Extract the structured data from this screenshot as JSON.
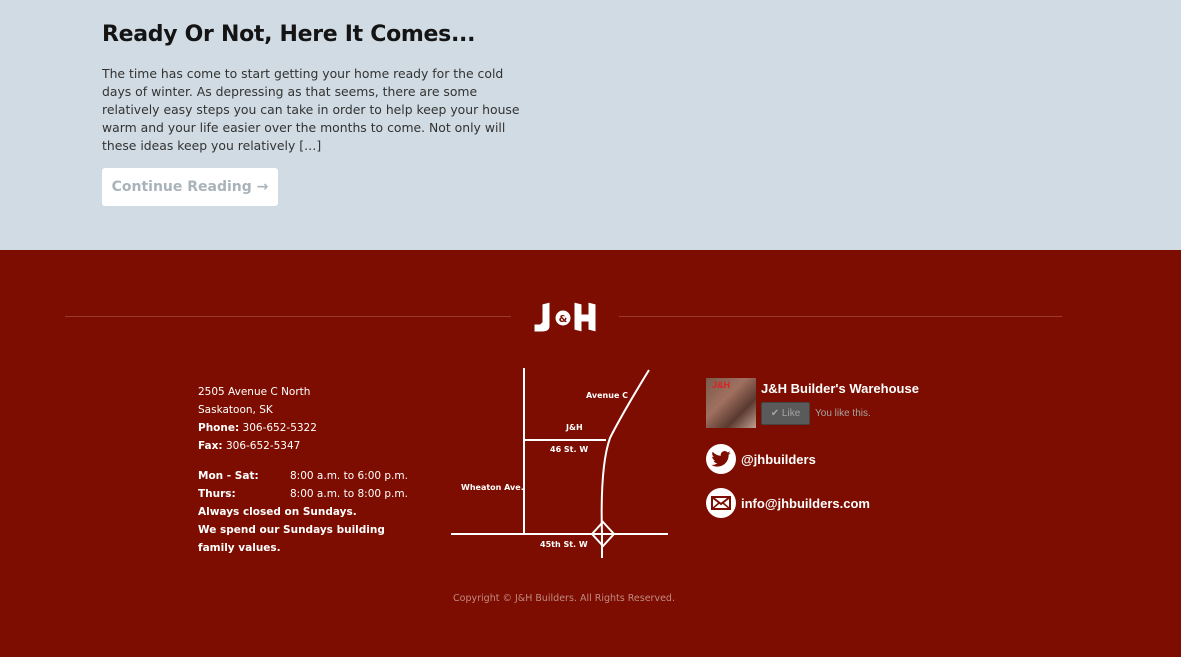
{
  "post": {
    "title": "Ready Or Not, Here It Comes...",
    "excerpt": "The time has come to start getting your home ready for the cold days of winter. As depressing as that seems, there are some relatively easy steps you can take in order to help keep your house warm and your life easier over the months to come. Not only will these ideas keep you relatively […]",
    "continue_label": "Continue Reading →"
  },
  "footer": {
    "logo_text": "J&H",
    "contact": {
      "address_line1": "2505 Avenue C North",
      "address_line2": "Saskatoon, SK",
      "phone_label": "Phone:",
      "phone": "306-652-5322",
      "fax_label": "Fax:",
      "fax": "306-652-5347"
    },
    "hours": [
      {
        "day": "Mon - Sat:",
        "time": "8:00 a.m. to 6:00 p.m."
      },
      {
        "day": "Thurs:",
        "time": "8:00 a.m. to 8:00 p.m."
      }
    ],
    "closed_note": "Always closed on Sundays.",
    "family_note": "We spend our Sundays building family values.",
    "map": {
      "labels": {
        "avenue_c": "Avenue C",
        "st46": "46 St. W",
        "wheaton": "Wheaton Ave.",
        "st45": "45th St. W"
      }
    },
    "facebook": {
      "avatar_text": "J&H",
      "page_name": "J&H Builder's Warehouse",
      "like_label": "Like",
      "like_status": "You like this."
    },
    "twitter": {
      "handle": "@jhbuilders"
    },
    "email": {
      "address": "info@jhbuilders.com"
    },
    "copyright": "Copyright © J&H Builders. All Rights Reserved."
  },
  "colors": {
    "post_bg": "#d0dbe3",
    "footer_bg": "#7c0d00",
    "text_dark": "#141414",
    "button_text": "#a9b3ba"
  }
}
